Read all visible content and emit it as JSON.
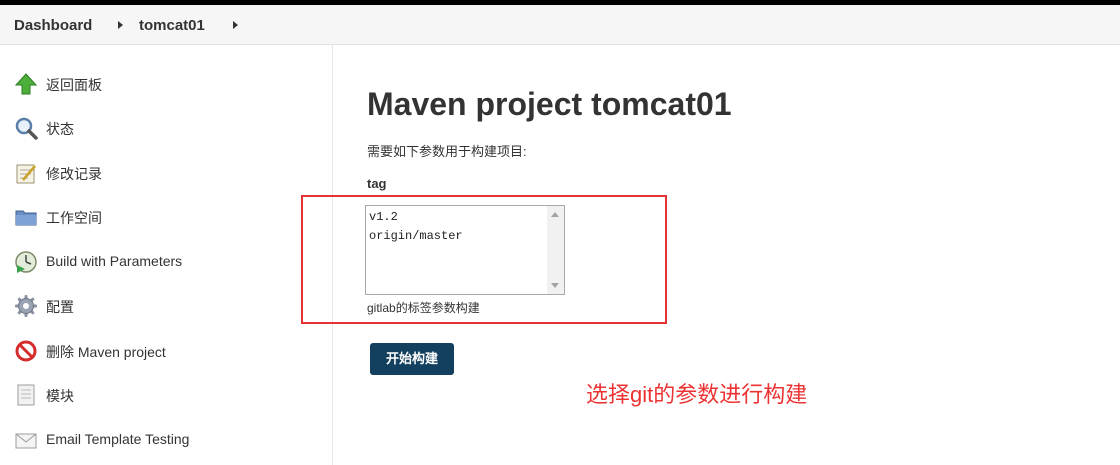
{
  "breadcrumb": {
    "items": [
      "Dashboard",
      "tomcat01"
    ]
  },
  "sidebar": {
    "items": [
      {
        "label": "返回面板",
        "icon": "arrow-up-icon"
      },
      {
        "label": "状态",
        "icon": "magnifier-icon"
      },
      {
        "label": "修改记录",
        "icon": "notepad-icon"
      },
      {
        "label": "工作空间",
        "icon": "folder-icon"
      },
      {
        "label": "Build with Parameters",
        "icon": "build-clock-icon"
      },
      {
        "label": "配置",
        "icon": "gear-icon"
      },
      {
        "label": "删除 Maven project",
        "icon": "no-entry-icon"
      },
      {
        "label": "模块",
        "icon": "document-icon"
      },
      {
        "label": "Email Template Testing",
        "icon": "envelope-icon"
      }
    ]
  },
  "main": {
    "title": "Maven project tomcat01",
    "subtitle": "需要如下参数用于构建项目:",
    "param": {
      "name": "tag",
      "options": [
        "v1.2",
        "origin/master"
      ],
      "description": "gitlab的标签参数构建"
    },
    "build_button": "开始构建"
  },
  "annotation": {
    "text": "选择git的参数进行构建",
    "color": "#ec3333"
  },
  "colors": {
    "button": "#14405f",
    "frame": "#e53333"
  }
}
